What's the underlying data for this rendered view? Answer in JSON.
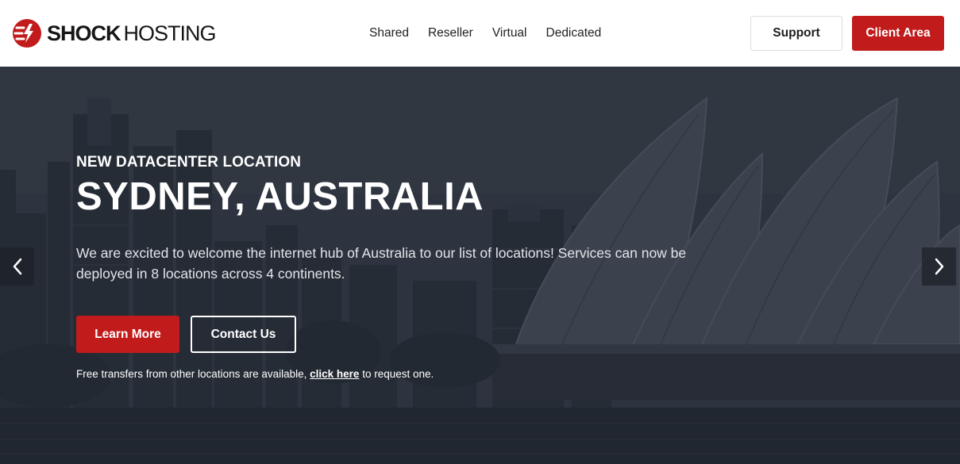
{
  "brand": {
    "name_bold": "SHOCK",
    "name_light": "HOSTING",
    "logo_icon": "lightning-logo-icon",
    "accent": "#c11b1b"
  },
  "nav": {
    "items": [
      "Shared",
      "Reseller",
      "Virtual",
      "Dedicated"
    ],
    "support_label": "Support",
    "client_area_label": "Client Area"
  },
  "hero": {
    "eyebrow": "NEW DATACENTER LOCATION",
    "title": "SYDNEY, AUSTRALIA",
    "description": "We are excited to welcome the internet hub of Australia to our list of locations! Services can now be deployed in 8 locations across 4 continents.",
    "learn_more_label": "Learn More",
    "contact_label": "Contact Us",
    "note_prefix": "Free transfers from other locations are available, ",
    "note_link": "click here",
    "note_suffix": " to request one.",
    "prev_icon": "chevron-left-icon",
    "next_icon": "chevron-right-icon"
  }
}
